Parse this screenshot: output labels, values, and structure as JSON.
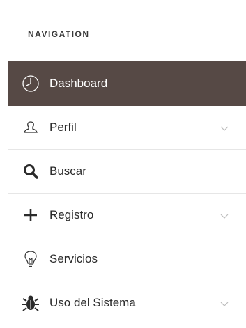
{
  "nav": {
    "heading": "NAVIGATION",
    "items": [
      {
        "label": "Dashboard",
        "icon": "clock-icon",
        "active": true,
        "has_submenu": false
      },
      {
        "label": "Perfil",
        "icon": "user-icon",
        "active": false,
        "has_submenu": true
      },
      {
        "label": "Buscar",
        "icon": "search-icon",
        "active": false,
        "has_submenu": false
      },
      {
        "label": "Registro",
        "icon": "plus-icon",
        "active": false,
        "has_submenu": true
      },
      {
        "label": "Servicios",
        "icon": "lightbulb-icon",
        "active": false,
        "has_submenu": false
      },
      {
        "label": "Uso del Sistema",
        "icon": "bug-icon",
        "active": false,
        "has_submenu": true
      }
    ]
  },
  "colors": {
    "active_background": "#564945",
    "active_text": "#ffffff",
    "text": "#2b2b2b",
    "divider": "#e6e6e6"
  }
}
